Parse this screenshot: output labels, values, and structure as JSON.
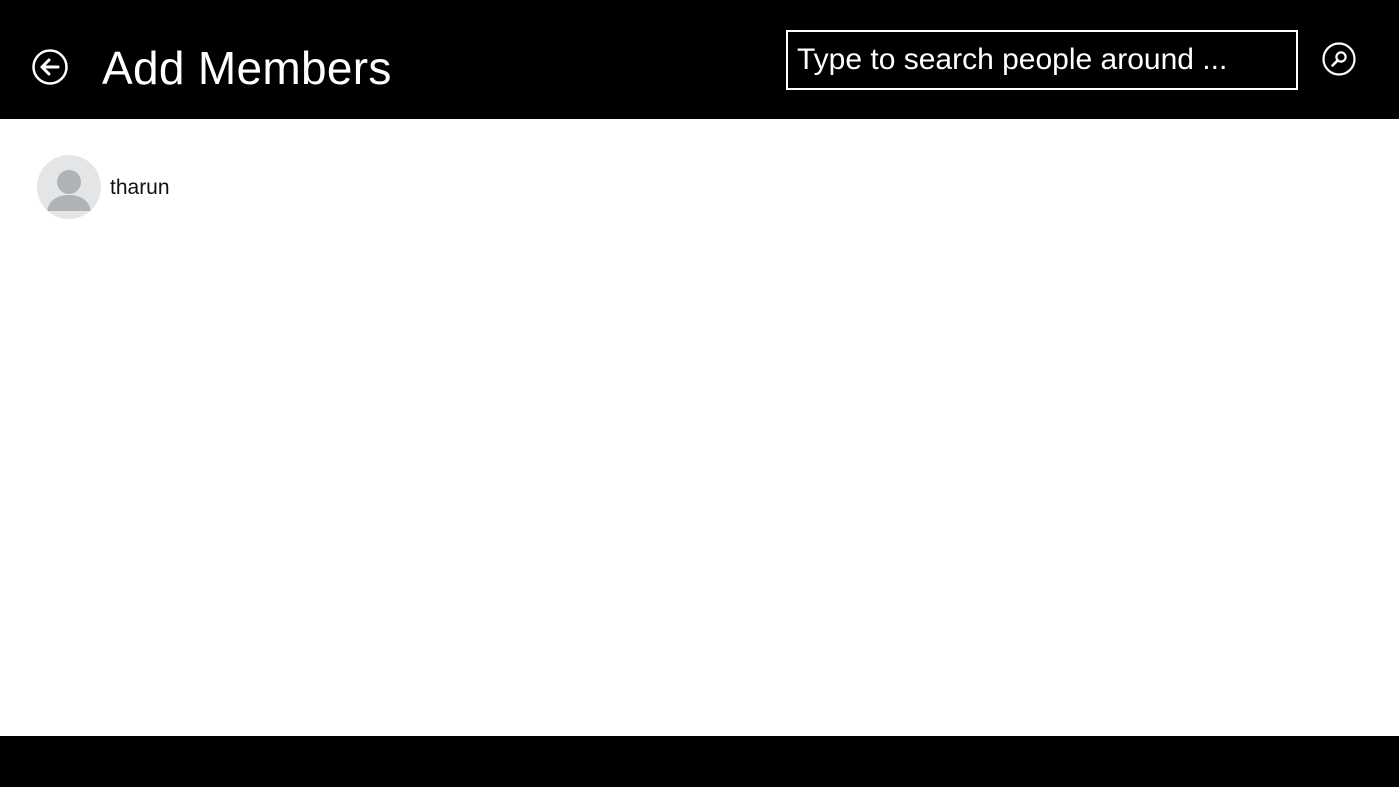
{
  "header": {
    "title": "Add Members",
    "back_icon": "back-arrow-circle-icon",
    "search": {
      "placeholder": "Type to search people around ...",
      "value": ""
    },
    "search_icon": "search-circle-icon"
  },
  "members": [
    {
      "name": "tharun",
      "avatar_icon": "default-person-icon"
    }
  ],
  "colors": {
    "header_background": "#000000",
    "content_background": "#ffffff",
    "avatar_background": "#e4e5e6",
    "avatar_figure": "#b0b3b6",
    "bottom_bar_background": "#000000"
  }
}
